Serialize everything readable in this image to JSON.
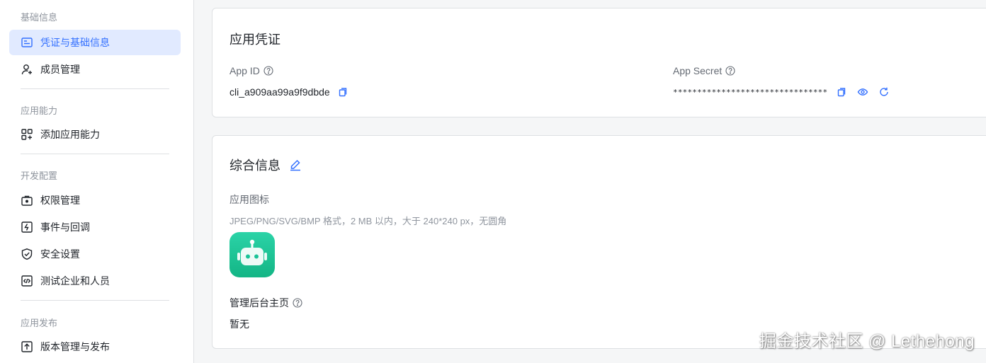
{
  "sidebar": {
    "groups": [
      {
        "title": "基础信息"
      },
      {
        "title": "应用能力"
      },
      {
        "title": "开发配置"
      },
      {
        "title": "应用发布"
      }
    ],
    "items": [
      {
        "label": "凭证与基础信息",
        "icon": "credential-icon",
        "active": true
      },
      {
        "label": "成员管理",
        "icon": "user-add-icon"
      },
      {
        "label": "添加应用能力",
        "icon": "app-grid-add-icon"
      },
      {
        "label": "权限管理",
        "icon": "permission-icon"
      },
      {
        "label": "事件与回调",
        "icon": "event-icon"
      },
      {
        "label": "安全设置",
        "icon": "shield-icon"
      },
      {
        "label": "测试企业和人员",
        "icon": "code-test-icon"
      },
      {
        "label": "版本管理与发布",
        "icon": "upload-icon"
      }
    ]
  },
  "credentials": {
    "title": "应用凭证",
    "app_id_label": "App ID",
    "app_id_value": "cli_a909aa99a9f9dbde",
    "app_secret_label": "App Secret",
    "app_secret_value": "********************************"
  },
  "general": {
    "title": "综合信息",
    "icon_label": "应用图标",
    "icon_hint": "JPEG/PNG/SVG/BMP 格式，2 MB 以内，大于 240*240 px，无圆角",
    "admin_home_label": "管理后台主页",
    "admin_home_value": "暂无"
  },
  "watermark": "掘金技术社区 @ Lethehong",
  "colors": {
    "accent": "#3370ff",
    "active_bg": "#e1eaff",
    "app_icon": "#19c397"
  }
}
